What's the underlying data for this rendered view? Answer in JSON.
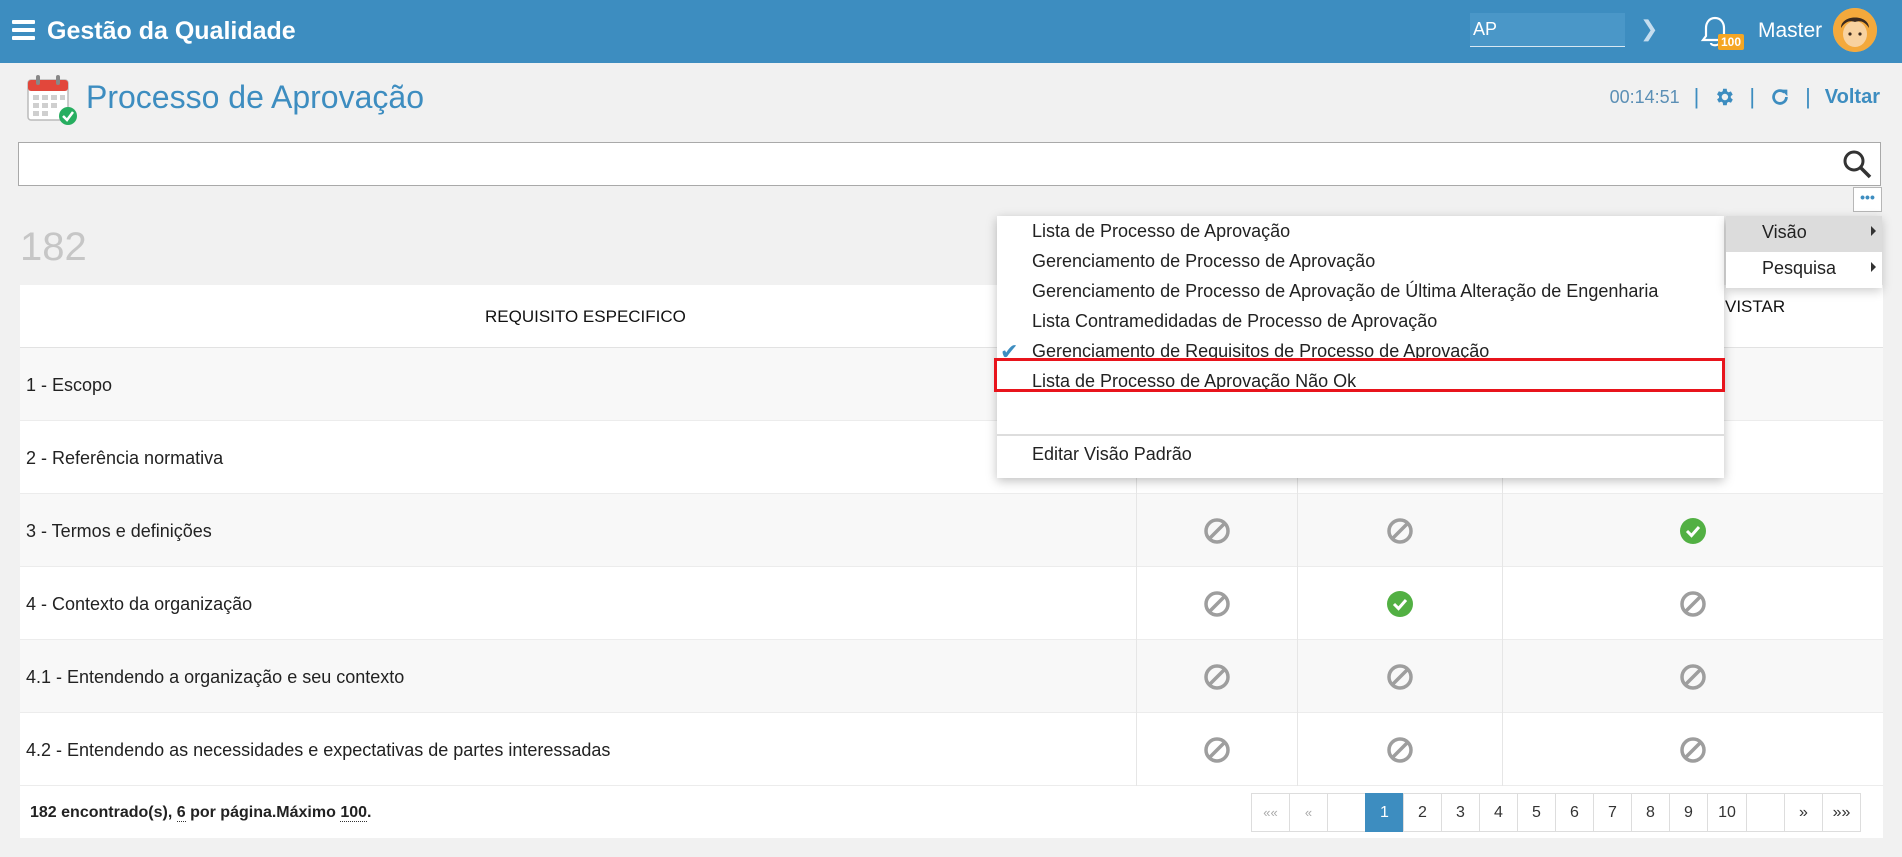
{
  "app": {
    "title": "Gestão da Qualidade"
  },
  "topbar": {
    "search_value": "AP",
    "user_name": "Master",
    "notification_count": "100"
  },
  "page": {
    "title": "Processo de Aprovação",
    "timer": "00:14:51",
    "back_label": "Voltar",
    "result_count": "182"
  },
  "table": {
    "header_requisito": "REQUISITO ESPECIFICO",
    "header_col3_partial": "VISTAR",
    "rows": [
      {
        "label": "1 - Escopo",
        "c1": "",
        "c2": "",
        "c3": ""
      },
      {
        "label": "2 - Referência normativa",
        "c1": "",
        "c2": "",
        "c3": ""
      },
      {
        "label": "3 - Termos e definições",
        "c1": "blocked",
        "c2": "blocked",
        "c3": "ok"
      },
      {
        "label": "4 - Contexto da organização",
        "c1": "blocked",
        "c2": "ok",
        "c3": "blocked"
      },
      {
        "label": "4.1 - Entendendo a organização e seu contexto",
        "c1": "blocked",
        "c2": "blocked",
        "c3": "blocked"
      },
      {
        "label": "4.2 - Entendendo as necessidades e expectativas de partes interessadas",
        "c1": "blocked",
        "c2": "blocked",
        "c3": "blocked"
      }
    ]
  },
  "footer": {
    "found_text": "182 encontrado(s),",
    "per_page": "6",
    "per_page_text": "por página.Máximo",
    "max": "100",
    "period": "."
  },
  "pager": {
    "first": "««",
    "prev": "«",
    "pages": [
      "1",
      "2",
      "3",
      "4",
      "5",
      "6",
      "7",
      "8",
      "9",
      "10"
    ],
    "active_page": "1",
    "next": "»",
    "last": "»»"
  },
  "menu": {
    "items": [
      "Lista de Processo de Aprovação",
      "Gerenciamento de Processo de Aprovação",
      "Gerenciamento de Processo de Aprovação de Última Alteração de Engenharia",
      "Lista Contramedidadas de Processo de Aprovação",
      "Gerenciamento de Requisitos de Processo de Aprovação",
      "Lista de Processo de Aprovação Não Ok"
    ],
    "selected_index": 4,
    "edit_default": "Editar Visão Padrão"
  },
  "side_menu": {
    "visao": "Visão",
    "pesquisa": "Pesquisa"
  },
  "colors": {
    "brand": "#3d8dc0",
    "ok": "#52b043",
    "blocked": "#9e9e9e",
    "highlight": "#e8141c"
  }
}
